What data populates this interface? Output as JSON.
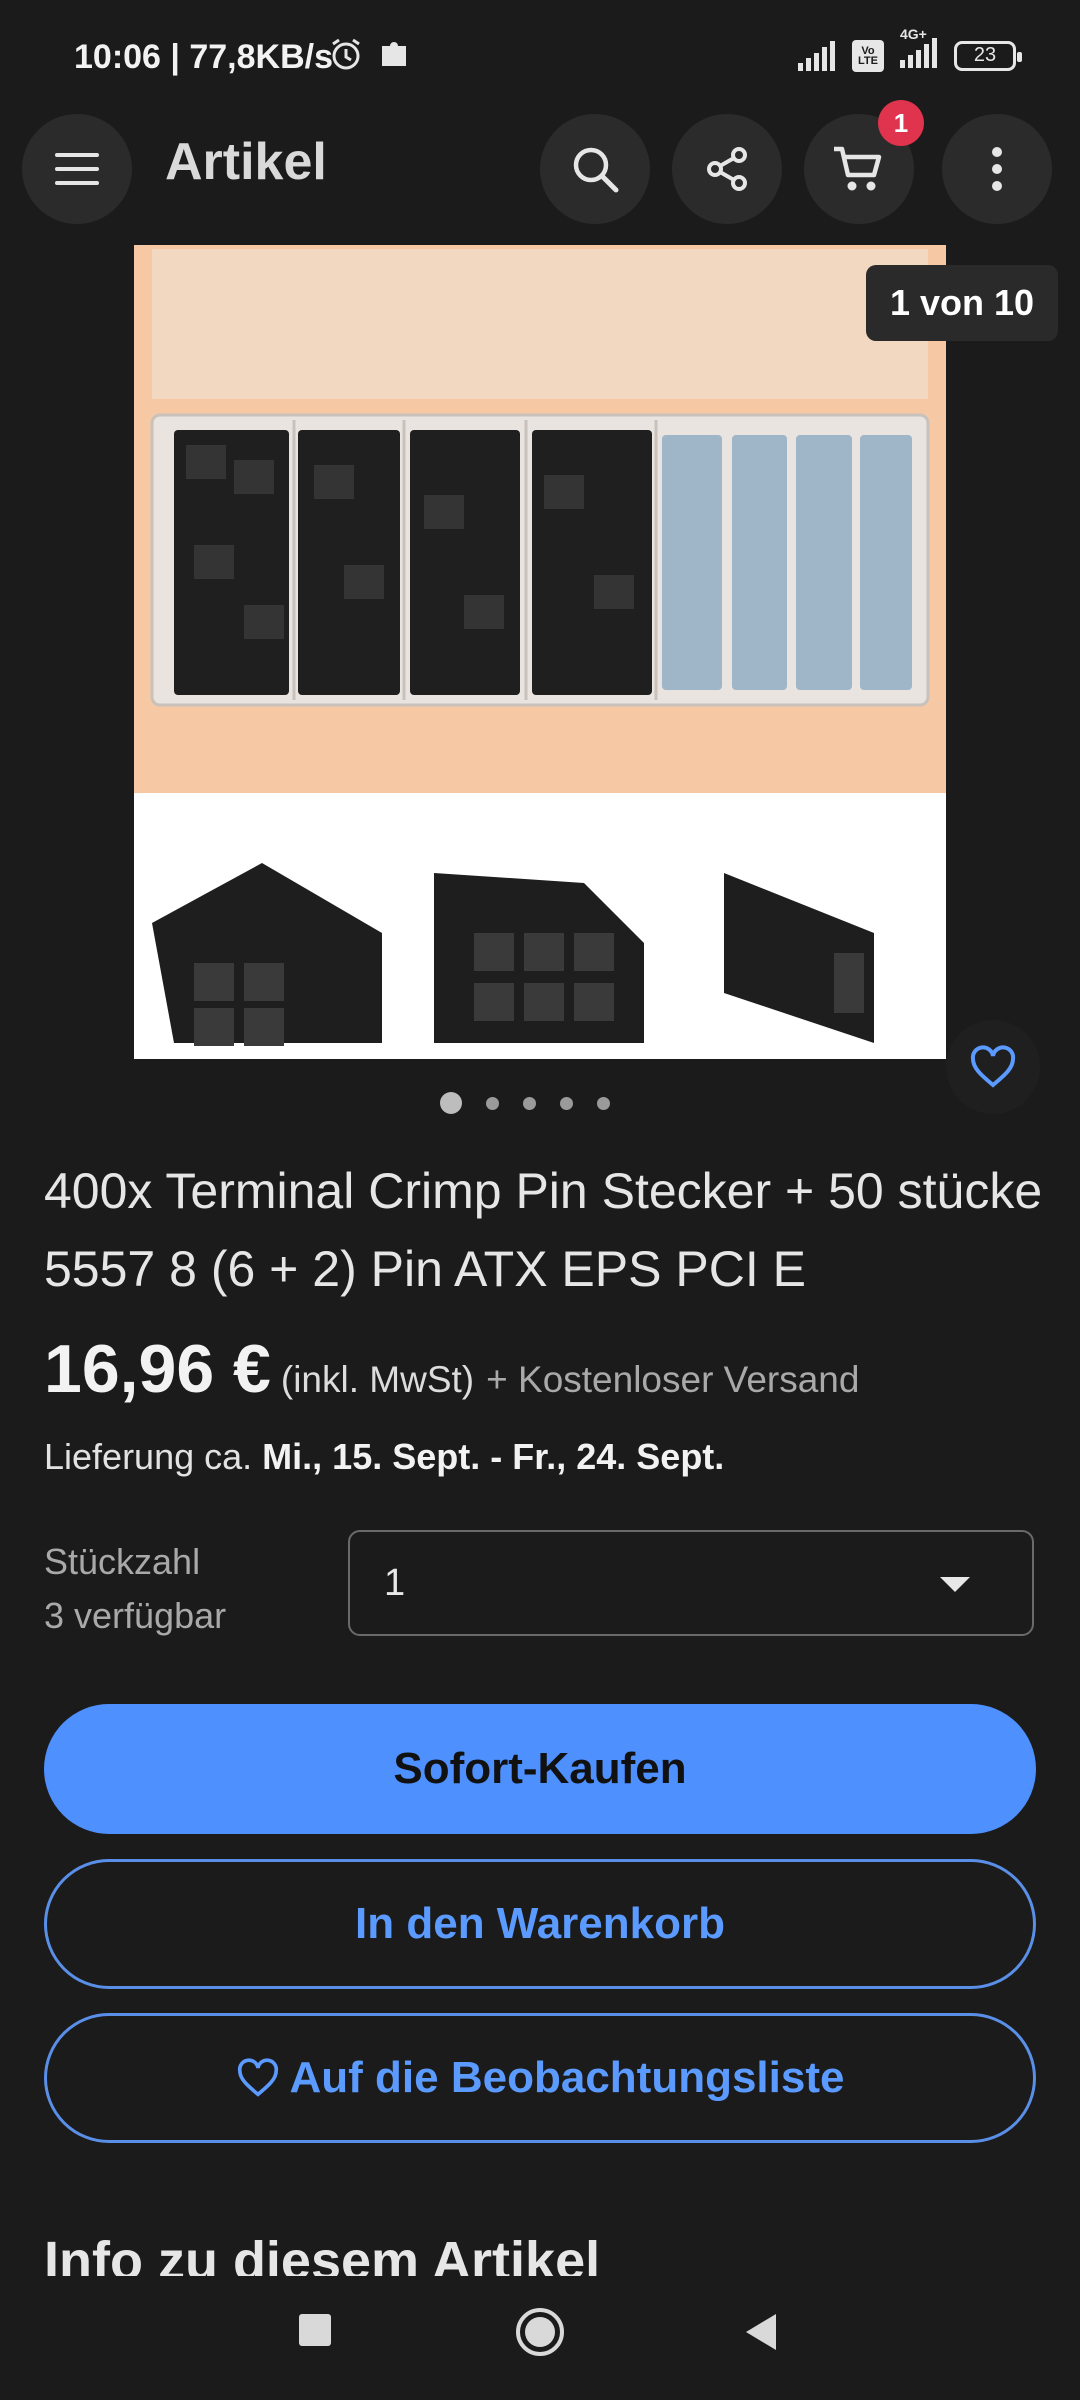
{
  "status_bar": {
    "time": "10:06 | 77,8KB/s",
    "lte_label": "Vo LTE",
    "network": "4G+",
    "battery": "23"
  },
  "app_bar": {
    "title": "Artikel",
    "cart_count": "1"
  },
  "gallery": {
    "counter": "1 von 10",
    "page_count": 5,
    "active_index": 0,
    "top_image": "connector kit in plastic organizer box",
    "bottom_image": "three black power connectors"
  },
  "product": {
    "title": "400x Terminal Crimp Pin Stecker + 50 stücke 5557 8 (6 + 2) Pin ATX EPS PCI E",
    "price": "16,96 €",
    "tax_note": "(inkl. MwSt)",
    "shipping": "+ Kostenloser Versand",
    "delivery_prefix": "Lieferung ca.",
    "delivery_dates": "Mi., 15. Sept. - Fr., 24. Sept."
  },
  "quantity": {
    "label": "Stückzahl",
    "available": "3 verfügbar",
    "selected": "1"
  },
  "actions": {
    "buy_now": "Sofort-Kaufen",
    "add_to_cart": "In den Warenkorb",
    "watch": "Auf die Beobachtungsliste"
  },
  "section": {
    "title": "Info zu diesem Artikel"
  },
  "colors": {
    "accent": "#4d90fe",
    "background": "#1b1b1b",
    "badge": "#e0334d"
  }
}
